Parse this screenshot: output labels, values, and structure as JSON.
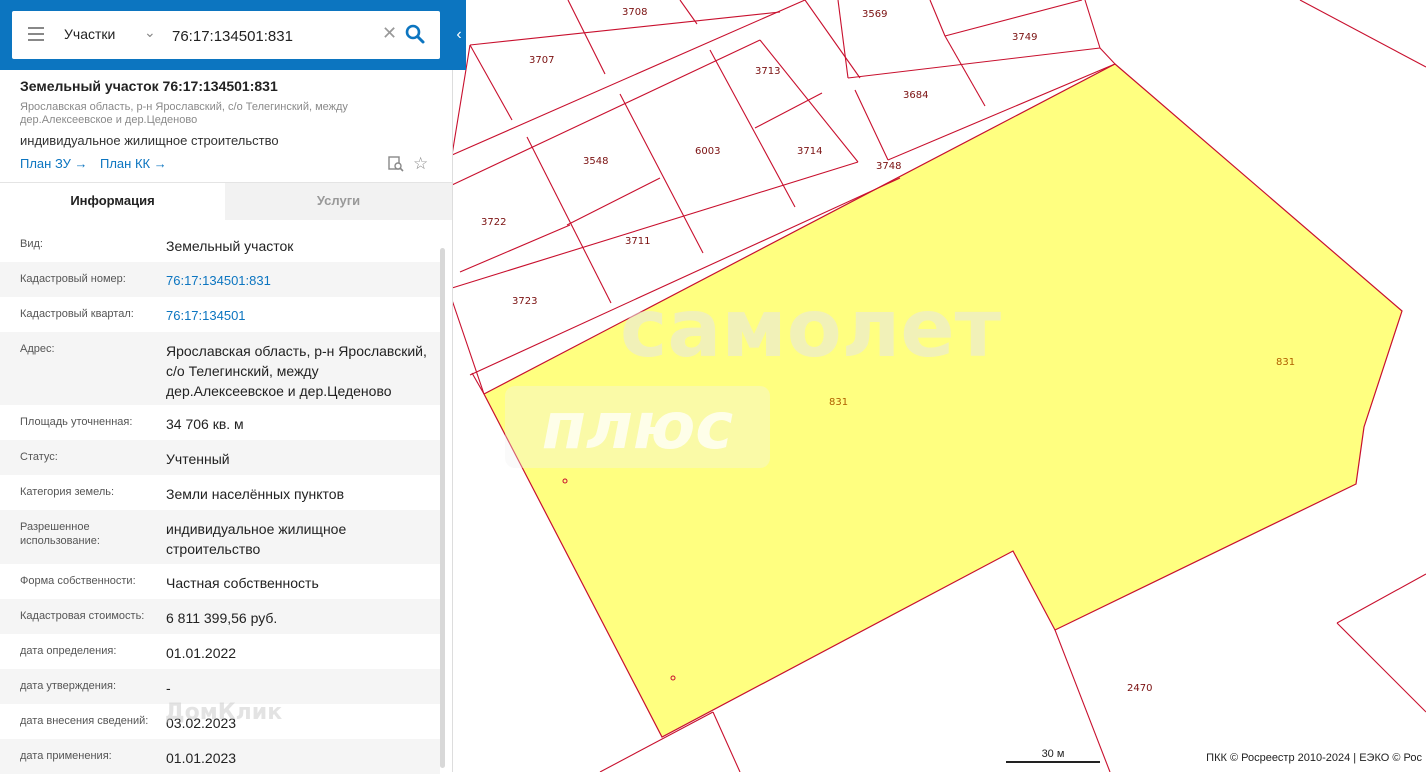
{
  "search": {
    "layer": "Участки",
    "query": "76:17:134501:831"
  },
  "parcel": {
    "title": "Земельный участок 76:17:134501:831",
    "address": "Ярославская область, р-н Ярославский, с/о Телегинский, между дер.Алексеевское и дер.Цеденово",
    "use": "индивидуальное жилищное строительство",
    "plan_zu": "План ЗУ →",
    "plan_kk": "План КК →"
  },
  "tabs": {
    "info": "Информация",
    "services": "Услуги"
  },
  "rows": [
    {
      "key": "Вид:",
      "value": "Земельный участок"
    },
    {
      "key": "Кадастровый номер:",
      "value": "76:17:134501:831"
    },
    {
      "key": "Кадастровый квартал:",
      "value": "76:17:134501"
    },
    {
      "key": "Адрес:",
      "value": "Ярославская область, р-н Ярославский, с/о Телегинский, между дер.Алексеевское и дер.Цеденово"
    },
    {
      "key": "Площадь уточненная:",
      "value": "34 706 кв. м"
    },
    {
      "key": "Статус:",
      "value": "Учтенный"
    },
    {
      "key": "Категория земель:",
      "value": "Земли населённых пунктов"
    },
    {
      "key": "Разрешенное использование:",
      "value": "индивидуальное жилищное строительство"
    },
    {
      "key": "Форма собственности:",
      "value": "Частная собственность"
    },
    {
      "key": "Кадастровая стоимость:",
      "value": "6 811 399,56 руб."
    },
    {
      "key": "дата определения:",
      "value": "01.01.2022"
    },
    {
      "key": "дата утверждения:",
      "value": "-"
    },
    {
      "key": "дата внесения сведений:",
      "value": "03.02.2023"
    },
    {
      "key": "дата применения:",
      "value": "01.01.2023"
    }
  ],
  "map": {
    "plots": [
      "3708",
      "3569",
      "3749",
      "3707",
      "3713",
      "3684",
      "6003",
      "3548",
      "3714",
      "3748",
      "3722",
      "3711",
      "3723",
      "2470"
    ],
    "selected_label_1": "831",
    "selected_label_2": "831",
    "selected_color": "#ffff80",
    "boundary_color": "#c8102e",
    "watermark_1": "самолет",
    "watermark_2": "плюс",
    "watermark_3": "ДомКлик",
    "scale": "30 м",
    "attribution": "ПКК © Росреестр 2010-2024 | ЕЭКО © Рос"
  },
  "colors": {
    "accent": "#0c75c0"
  }
}
